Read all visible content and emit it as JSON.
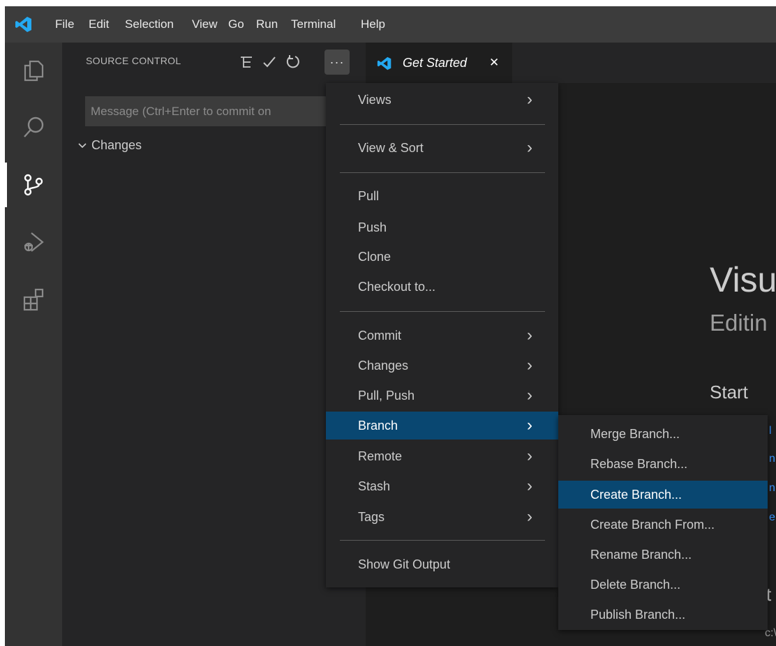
{
  "titlebar": {
    "menu": [
      "File",
      "Edit",
      "Selection",
      "View",
      "Go",
      "Run",
      "Terminal",
      "Help"
    ]
  },
  "activity_bar": [
    "explorer-icon",
    "search-icon",
    "source-control-icon",
    "run-debug-icon",
    "extensions-icon"
  ],
  "sidebar": {
    "title": "SOURCE CONTROL",
    "message_placeholder": "Message (Ctrl+Enter to commit on",
    "changes_label": "Changes"
  },
  "tab": {
    "label": "Get Started",
    "close": "✕"
  },
  "editor": {
    "heading": "Visu",
    "subheading": "Editin",
    "start": "Start",
    "bottom_partial": "t",
    "footer_path": "c:\\"
  },
  "menu": {
    "items": [
      {
        "label": "Views",
        "submenu": true
      },
      {
        "label": "View & Sort",
        "submenu": true
      },
      {
        "label": "Pull"
      },
      {
        "label": "Push"
      },
      {
        "label": "Clone"
      },
      {
        "label": "Checkout to..."
      },
      {
        "label": "Commit",
        "submenu": true
      },
      {
        "label": "Changes",
        "submenu": true
      },
      {
        "label": "Pull, Push",
        "submenu": true
      },
      {
        "label": "Branch",
        "submenu": true,
        "selected": true
      },
      {
        "label": "Remote",
        "submenu": true
      },
      {
        "label": "Stash",
        "submenu": true
      },
      {
        "label": "Tags",
        "submenu": true
      },
      {
        "label": "Show Git Output"
      }
    ]
  },
  "branch_submenu": {
    "items": [
      {
        "label": "Merge Branch..."
      },
      {
        "label": "Rebase Branch..."
      },
      {
        "label": "Create Branch...",
        "selected": true
      },
      {
        "label": "Create Branch From..."
      },
      {
        "label": "Rename Branch..."
      },
      {
        "label": "Delete Branch..."
      },
      {
        "label": "Publish Branch..."
      }
    ]
  },
  "colors": {
    "accent": "#0078d4",
    "selection": "#094771",
    "vscode_blue": "#23a9f2"
  }
}
